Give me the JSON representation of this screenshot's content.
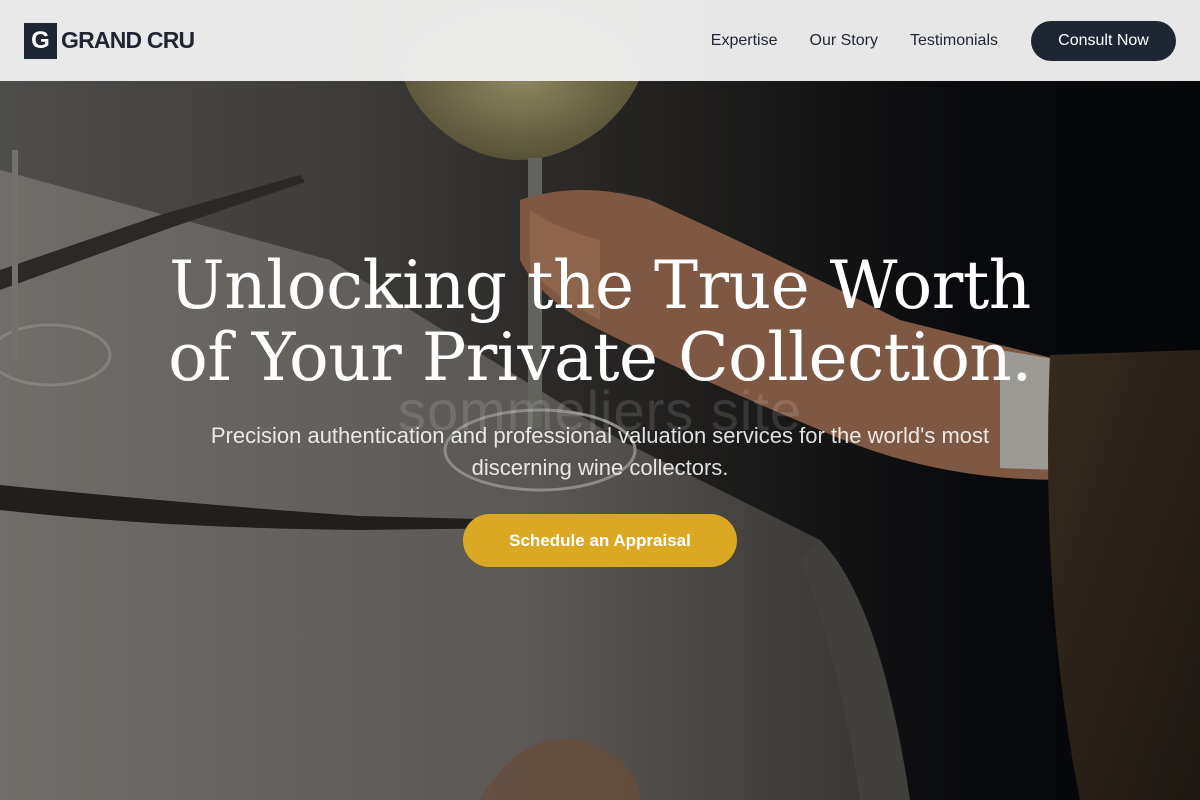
{
  "brand": {
    "mark": "G",
    "name": "GRAND CRU"
  },
  "nav": {
    "links": [
      {
        "label": "Expertise"
      },
      {
        "label": "Our Story"
      },
      {
        "label": "Testimonials"
      }
    ],
    "cta_label": "Consult Now"
  },
  "hero": {
    "title_line1": "Unlocking the True Worth",
    "title_line2": "of Your Private Collection.",
    "subtitle": "Precision authentication and professional valuation services for the world's most discerning wine collectors.",
    "cta_label": "Schedule an Appraisal",
    "watermark": "sommeliers site"
  },
  "colors": {
    "navy": "#1e2533",
    "gold": "#dba824",
    "header_bg": "#eeeeee"
  },
  "icons": {
    "logo": "letter-g-square"
  }
}
